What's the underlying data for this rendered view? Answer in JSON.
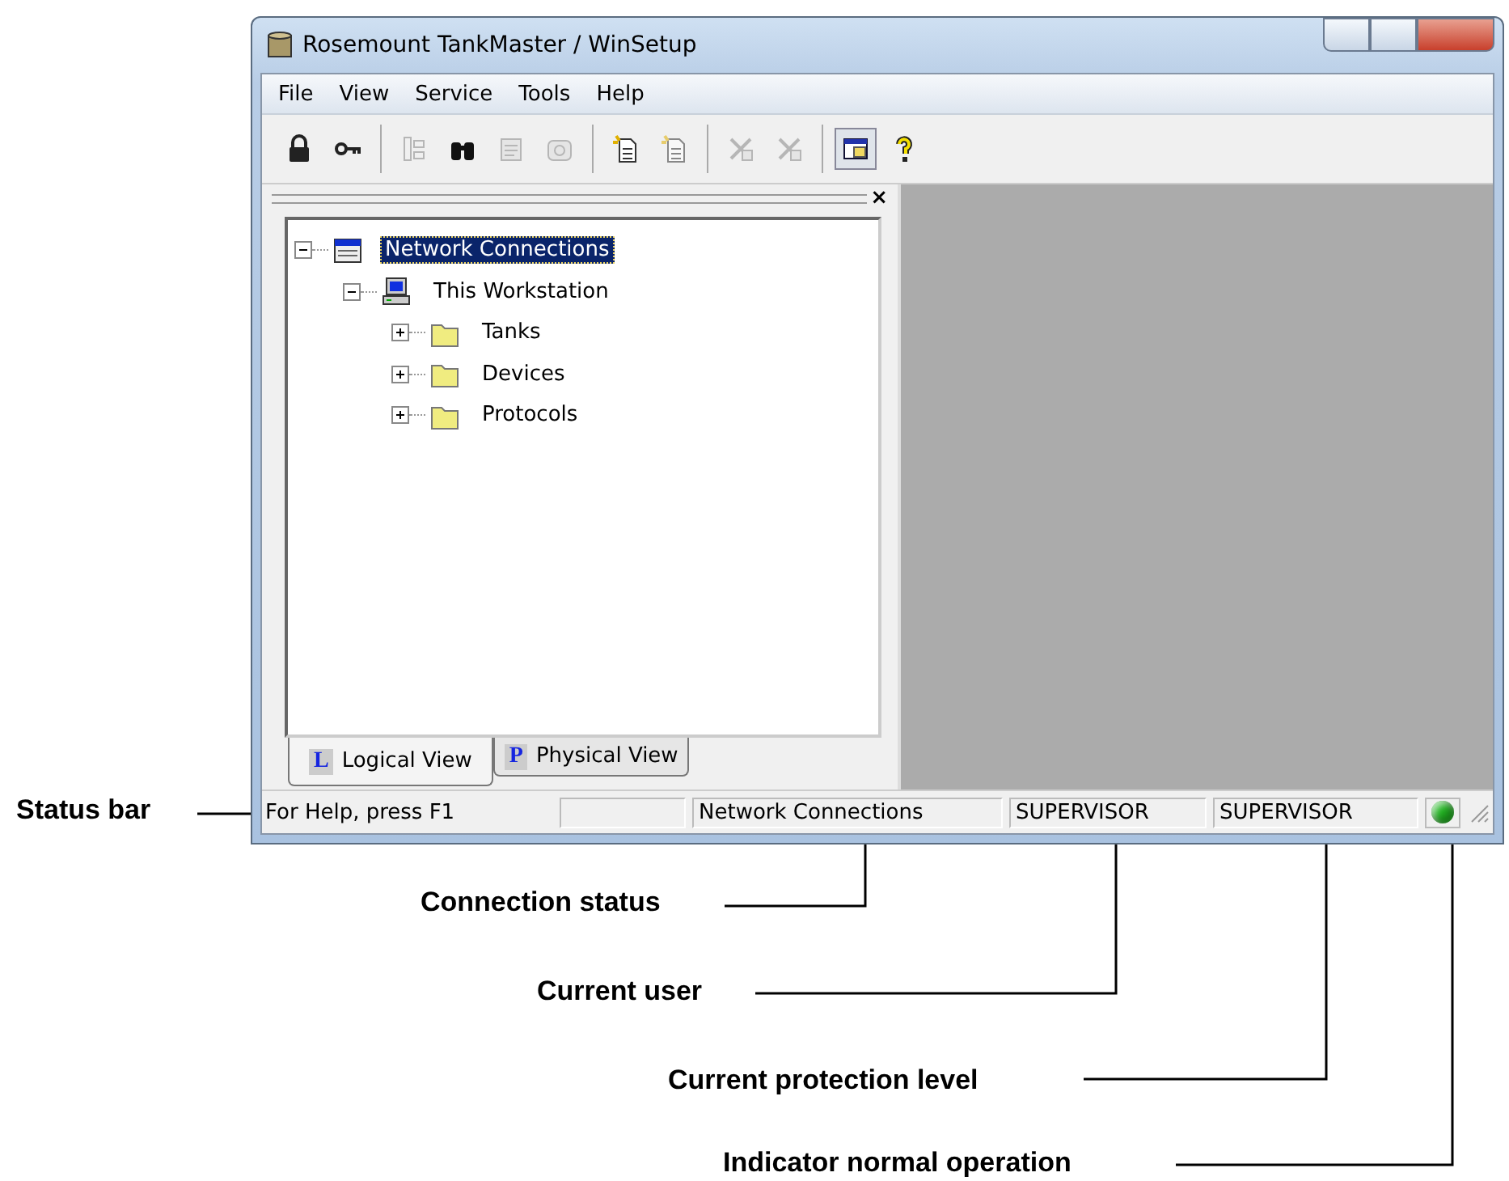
{
  "window": {
    "title": "Rosemount TankMaster / WinSetup"
  },
  "menu": [
    "File",
    "View",
    "Service",
    "Tools",
    "Help"
  ],
  "toolbar": [
    {
      "kind": "lock",
      "disabled": false,
      "pressed": false
    },
    {
      "kind": "key",
      "disabled": false,
      "pressed": false
    },
    {
      "kind": "sep"
    },
    {
      "kind": "tree",
      "disabled": true,
      "pressed": false
    },
    {
      "kind": "binoculars",
      "disabled": false,
      "pressed": false
    },
    {
      "kind": "properties",
      "disabled": true,
      "pressed": false
    },
    {
      "kind": "device",
      "disabled": true,
      "pressed": false
    },
    {
      "kind": "sep"
    },
    {
      "kind": "newdoc",
      "disabled": false,
      "pressed": false
    },
    {
      "kind": "newdoc",
      "disabled": true,
      "pressed": false
    },
    {
      "kind": "sep"
    },
    {
      "kind": "cut",
      "disabled": true,
      "pressed": false
    },
    {
      "kind": "cut",
      "disabled": true,
      "pressed": false
    },
    {
      "kind": "sep"
    },
    {
      "kind": "panel",
      "disabled": false,
      "pressed": true
    },
    {
      "kind": "help",
      "disabled": false,
      "pressed": false
    }
  ],
  "pane": {
    "close": "×"
  },
  "tree": [
    {
      "label": "Network Connections",
      "kind": "network",
      "expanded": true,
      "selected": true,
      "children": [
        {
          "label": "This Workstation",
          "kind": "computer",
          "expanded": true,
          "selected": false,
          "children": [
            {
              "label": "Tanks",
              "kind": "folder",
              "expanded": false,
              "selected": false
            },
            {
              "label": "Devices",
              "kind": "folder",
              "expanded": false,
              "selected": false
            },
            {
              "label": "Protocols",
              "kind": "folder",
              "expanded": false,
              "selected": false
            }
          ]
        }
      ]
    }
  ],
  "tabs": [
    {
      "letter": "L",
      "label": "Logical View",
      "selected": true
    },
    {
      "letter": "P",
      "label": "Physical View",
      "selected": false
    }
  ],
  "status_bar": {
    "help": "For Help, press F1",
    "panes": [
      "Network Connections",
      "SUPERVISOR",
      "SUPERVISOR"
    ],
    "indicator": {
      "color": "#22b422"
    }
  },
  "annotations": [
    {
      "kind": "status_bar",
      "label": "Status bar"
    },
    {
      "kind": "connection",
      "label": "Connection status"
    },
    {
      "kind": "user",
      "label": "Current user"
    },
    {
      "kind": "protection",
      "label": "Current protection level"
    },
    {
      "kind": "indicator",
      "label": "Indicator normal operation"
    }
  ]
}
